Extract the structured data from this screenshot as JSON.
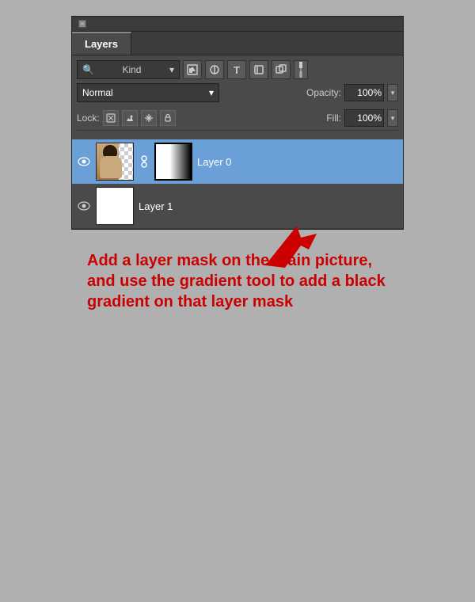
{
  "panel": {
    "close_x": "×",
    "tab_label": "Layers",
    "kind_label": "Kind",
    "blend_mode": "Normal",
    "opacity_label": "Opacity:",
    "opacity_value": "100%",
    "lock_label": "Lock:",
    "fill_label": "Fill:",
    "fill_value": "100%",
    "layers": [
      {
        "name": "Layer 0",
        "visible": true,
        "selected": true,
        "has_mask": true
      },
      {
        "name": "Layer 1",
        "visible": true,
        "selected": false,
        "has_mask": false
      }
    ],
    "annotation": "Add a layer mask on the main picture, and use the gradient tool to add a black gradient on that layer mask"
  },
  "icons": {
    "eye": "👁",
    "chain": "🔗",
    "close": "×",
    "dropdown_arrow": "▾",
    "kind_icon": "🔍"
  }
}
